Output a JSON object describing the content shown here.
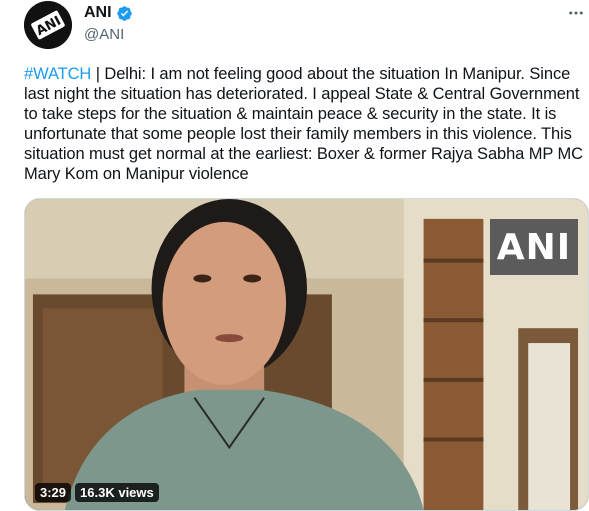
{
  "author": {
    "display_name": "ANI",
    "handle": "@ANI",
    "avatar_text": "ANI",
    "verified": true
  },
  "icons": {
    "verified": "verified-badge-icon",
    "more": "more-horizontal-icon"
  },
  "tweet": {
    "hashtag": "#WATCH",
    "text": " | Delhi: I am not feeling good about the situation In Manipur. Since last night the situation has deteriorated. I appeal State & Central Government to take steps for the situation & maintain peace & security in the state. It is unfortunate that some people lost their family members in this violence. This situation must get normal at the earliest: Boxer & former Rajya Sabha MP MC Mary Kom on Manipur violence"
  },
  "media": {
    "watermark": "ANI",
    "duration": "3:29",
    "views": "16.3K views"
  },
  "colors": {
    "link": "#1d9bf0",
    "verified": "#1d9bf0",
    "text": "#0f1419",
    "secondary": "#536471"
  }
}
